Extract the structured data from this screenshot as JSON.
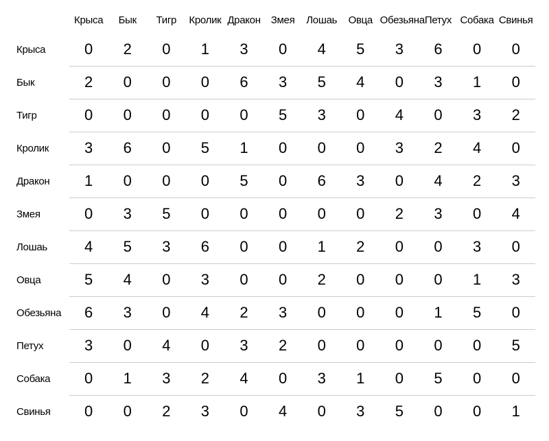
{
  "chart_data": {
    "type": "table",
    "title": "",
    "columns": [
      "Крыса",
      "Бык",
      "Тигр",
      "Кролик",
      "Дракон",
      "Змея",
      "Лошаь",
      "Овца",
      "Обезьяна",
      "Петух",
      "Собака",
      "Свинья"
    ],
    "rows": [
      "Крыса",
      "Бык",
      "Тигр",
      "Кролик",
      "Дракон",
      "Змея",
      "Лошаь",
      "Овца",
      "Обезьяна",
      "Петух",
      "Собака",
      "Свинья"
    ],
    "values": [
      [
        0,
        2,
        0,
        1,
        3,
        0,
        4,
        5,
        3,
        6,
        0,
        0
      ],
      [
        2,
        0,
        0,
        0,
        6,
        3,
        5,
        4,
        0,
        3,
        1,
        0
      ],
      [
        0,
        0,
        0,
        0,
        0,
        5,
        3,
        0,
        4,
        0,
        3,
        2
      ],
      [
        3,
        6,
        0,
        5,
        1,
        0,
        0,
        0,
        3,
        2,
        4,
        0
      ],
      [
        1,
        0,
        0,
        0,
        5,
        0,
        6,
        3,
        0,
        4,
        2,
        3
      ],
      [
        0,
        3,
        5,
        0,
        0,
        0,
        0,
        0,
        2,
        3,
        0,
        4
      ],
      [
        4,
        5,
        3,
        6,
        0,
        0,
        1,
        2,
        0,
        0,
        3,
        0
      ],
      [
        5,
        4,
        0,
        3,
        0,
        0,
        2,
        0,
        0,
        0,
        1,
        3
      ],
      [
        6,
        3,
        0,
        4,
        2,
        3,
        0,
        0,
        0,
        1,
        5,
        0
      ],
      [
        3,
        0,
        4,
        0,
        3,
        2,
        0,
        0,
        0,
        0,
        0,
        5
      ],
      [
        0,
        1,
        3,
        2,
        4,
        0,
        3,
        1,
        0,
        5,
        0,
        0
      ],
      [
        0,
        0,
        2,
        3,
        0,
        4,
        0,
        3,
        5,
        0,
        0,
        1
      ]
    ]
  }
}
